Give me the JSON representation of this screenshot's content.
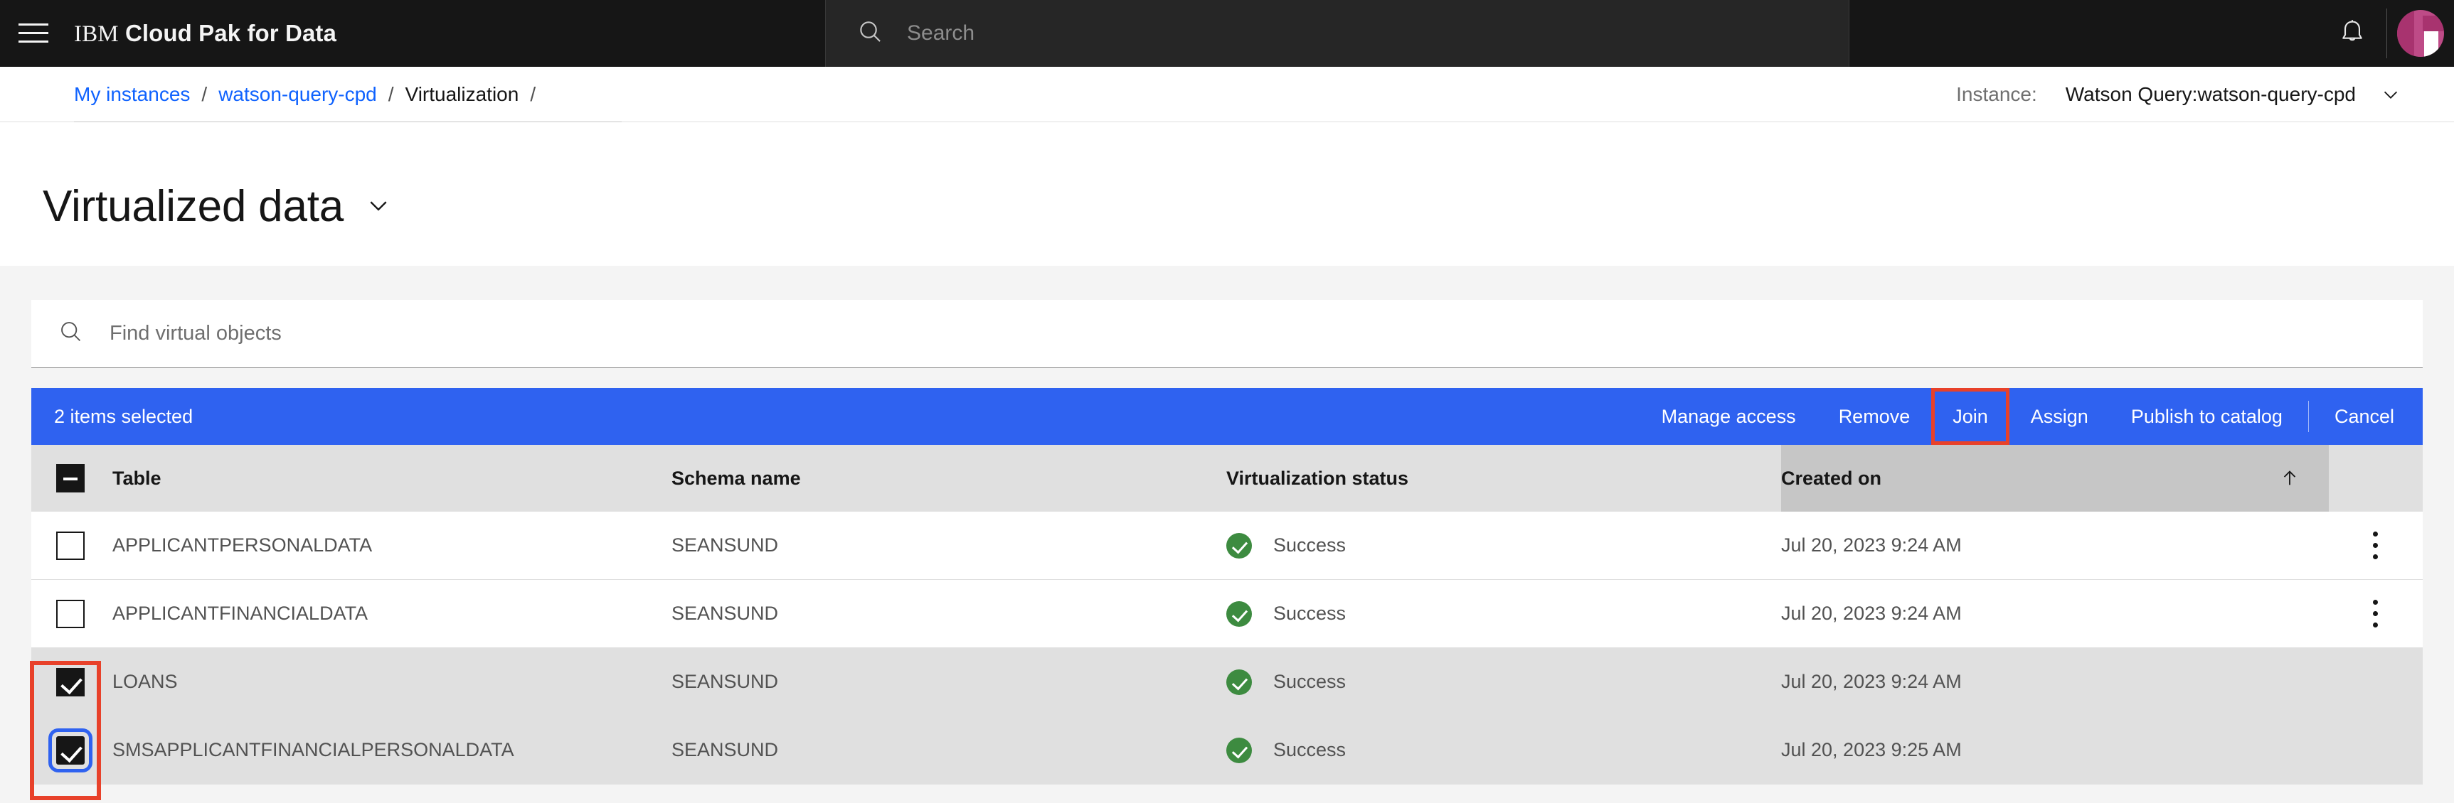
{
  "header": {
    "menu_icon": "hamburger-menu-icon",
    "brand_prefix": "IBM",
    "brand_rest": "Cloud Pak for Data",
    "search_placeholder": "Search",
    "search_icon": "search-icon",
    "bell_icon": "notification-bell-icon",
    "avatar": "user-avatar",
    "bg": "#161616",
    "search_bg": "#262626"
  },
  "breadcrumb": {
    "items": [
      {
        "label": "My instances",
        "link": true
      },
      {
        "label": "watson-query-cpd",
        "link": true
      },
      {
        "label": "Virtualization",
        "link": false
      }
    ],
    "separator": "/",
    "trailing_separator": "/",
    "link_color": "#0f62fe"
  },
  "instance": {
    "label": "Instance:",
    "value": "Watson Query:watson-query-cpd",
    "chevron_icon": "chevron-down-icon"
  },
  "page": {
    "title": "Virtualized data",
    "title_chevron_icon": "chevron-down-icon"
  },
  "find": {
    "placeholder": "Find virtual objects",
    "value": "",
    "icon": "search-icon"
  },
  "batch": {
    "count_label": "2 items selected",
    "bg": "#2f62f0",
    "actions": [
      {
        "label": "Manage access",
        "highlighted": false
      },
      {
        "label": "Remove",
        "highlighted": false
      },
      {
        "label": "Join",
        "highlighted": true
      },
      {
        "label": "Assign",
        "highlighted": false
      },
      {
        "label": "Publish to catalog",
        "highlighted": false
      }
    ],
    "cancel_label": "Cancel",
    "highlight_color": "#e8412a"
  },
  "table": {
    "select_all_state": "indeterminate",
    "columns": [
      {
        "label": "Table",
        "key": "table"
      },
      {
        "label": "Schema name",
        "key": "schema"
      },
      {
        "label": "Virtualization status",
        "key": "status"
      },
      {
        "label": "Created on",
        "key": "created",
        "sorted": true,
        "sort_dir": "asc",
        "sort_icon": "arrow-up-icon"
      }
    ],
    "rows": [
      {
        "table": "APPLICANTPERSONALDATA",
        "schema": "SEANSUND",
        "status": "Success",
        "status_icon": "checkmark-filled-icon",
        "created": "Jul 20, 2023 9:24 AM",
        "selected": false,
        "overflow": true,
        "focused": false
      },
      {
        "table": "APPLICANTFINANCIALDATA",
        "schema": "SEANSUND",
        "status": "Success",
        "status_icon": "checkmark-filled-icon",
        "created": "Jul 20, 2023 9:24 AM",
        "selected": false,
        "overflow": true,
        "focused": false
      },
      {
        "table": "LOANS",
        "schema": "SEANSUND",
        "status": "Success",
        "status_icon": "checkmark-filled-icon",
        "created": "Jul 20, 2023 9:24 AM",
        "selected": true,
        "overflow": false,
        "focused": false
      },
      {
        "table": "SMSAPPLICANTFINANCIALPERSONALDATA",
        "schema": "SEANSUND",
        "status": "Success",
        "status_icon": "checkmark-filled-icon",
        "created": "Jul 20, 2023 9:25 AM",
        "selected": true,
        "overflow": false,
        "focused": true
      }
    ],
    "status_color": "#3d8b40",
    "header_bg": "#e0e0e0",
    "sorted_col_bg": "#c6c6c6",
    "selected_row_bg": "#e0e0e0"
  },
  "annotations": {
    "checkbox_box_color": "#e8412a",
    "focus_ring_color": "#2f62f0"
  }
}
